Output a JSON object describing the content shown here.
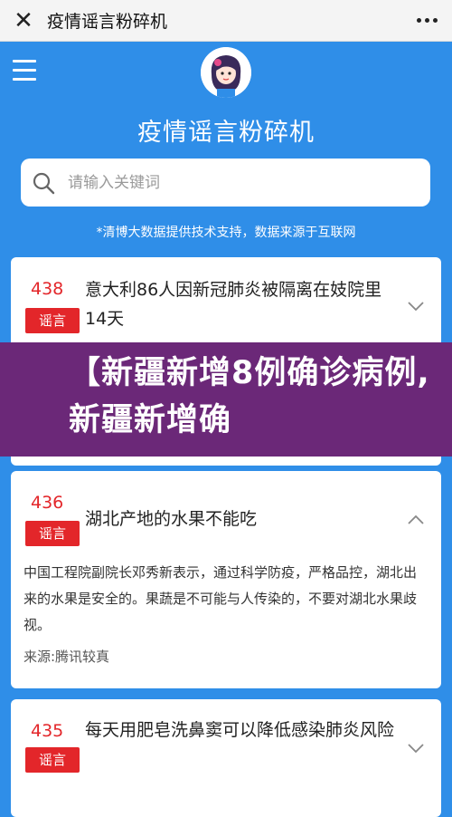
{
  "topbar": {
    "close_icon": "close-icon",
    "title": "疫情谣言粉碎机",
    "more_icon": "more-icon"
  },
  "header": {
    "menu_icon": "hamburger-menu-icon",
    "mascot": "mascot-avatar",
    "title": "疫情谣言粉碎机"
  },
  "search": {
    "placeholder": "请输入关键词",
    "icon": "search-icon"
  },
  "source_note": "*清博大数据提供技术支持，数据来源于互联网",
  "banner": {
    "text": "【新疆新增8例确诊病例,新疆新增确"
  },
  "cards": [
    {
      "number": "438",
      "tag": "谣言",
      "headline": "意大利86人因新冠肺炎被隔离在妓院里14天",
      "expanded": false
    },
    {
      "number": "436",
      "tag": "谣言",
      "headline": "湖北产地的水果不能吃",
      "expanded": true,
      "body": "中国工程院副院长邓秀新表示，通过科学防疫，严格品控，湖北出来的水果是安全的。果蔬是不可能与人传染的，不要对湖北水果歧视。",
      "source": "来源:腾讯较真"
    },
    {
      "number": "435",
      "tag": "谣言",
      "headline": "每天用肥皂洗鼻窦可以降低感染肺炎风险",
      "expanded": false
    }
  ],
  "colors": {
    "brand_blue": "#2f8ee8",
    "rumor_red": "#e3262a",
    "banner_purple": "#6b2878"
  }
}
